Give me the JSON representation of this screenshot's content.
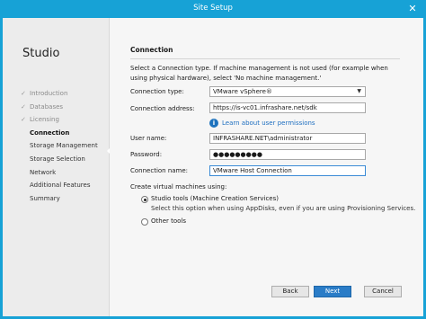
{
  "window": {
    "title": "Site Setup",
    "close_glyph": "✕"
  },
  "sidebar": {
    "brand": "Studio",
    "steps": [
      {
        "label": "Introduction",
        "state": "done"
      },
      {
        "label": "Databases",
        "state": "done"
      },
      {
        "label": "Licensing",
        "state": "done"
      },
      {
        "label": "Connection",
        "state": "active"
      },
      {
        "label": "Storage Management",
        "state": "pending"
      },
      {
        "label": "Storage Selection",
        "state": "pending"
      },
      {
        "label": "Network",
        "state": "pending"
      },
      {
        "label": "Additional Features",
        "state": "pending"
      },
      {
        "label": "Summary",
        "state": "pending"
      }
    ],
    "check_glyph": "✓"
  },
  "connection": {
    "heading": "Connection",
    "intro": "Select a Connection type. If machine management is not used (for example when using physical hardware), select 'No machine management.'",
    "type_label": "Connection type:",
    "type_value": "VMware vSphere®",
    "address_label": "Connection address:",
    "address_value": "https://is-vc01.infrashare.net/sdk",
    "info_glyph": "i",
    "learn_link": "Learn about user permissions",
    "username_label": "User name:",
    "username_value": "INFRASHARE.NET\\administrator",
    "password_label": "Password:",
    "password_value": "●●●●●●●●●",
    "name_label": "Connection name:",
    "name_value": "VMware Host Connection"
  },
  "vm_tools": {
    "title": "Create virtual machines using:",
    "option1": "Studio tools (Machine Creation Services)",
    "option1_desc": "Select this option when using AppDisks, even if you are using Provisioning Services.",
    "option2": "Other tools",
    "selected": "option1"
  },
  "buttons": {
    "back": "Back",
    "next": "Next",
    "cancel": "Cancel"
  },
  "colors": {
    "titlebar": "#17a2d6",
    "primary_button": "#2a7cc7",
    "link": "#1e6fc0"
  }
}
